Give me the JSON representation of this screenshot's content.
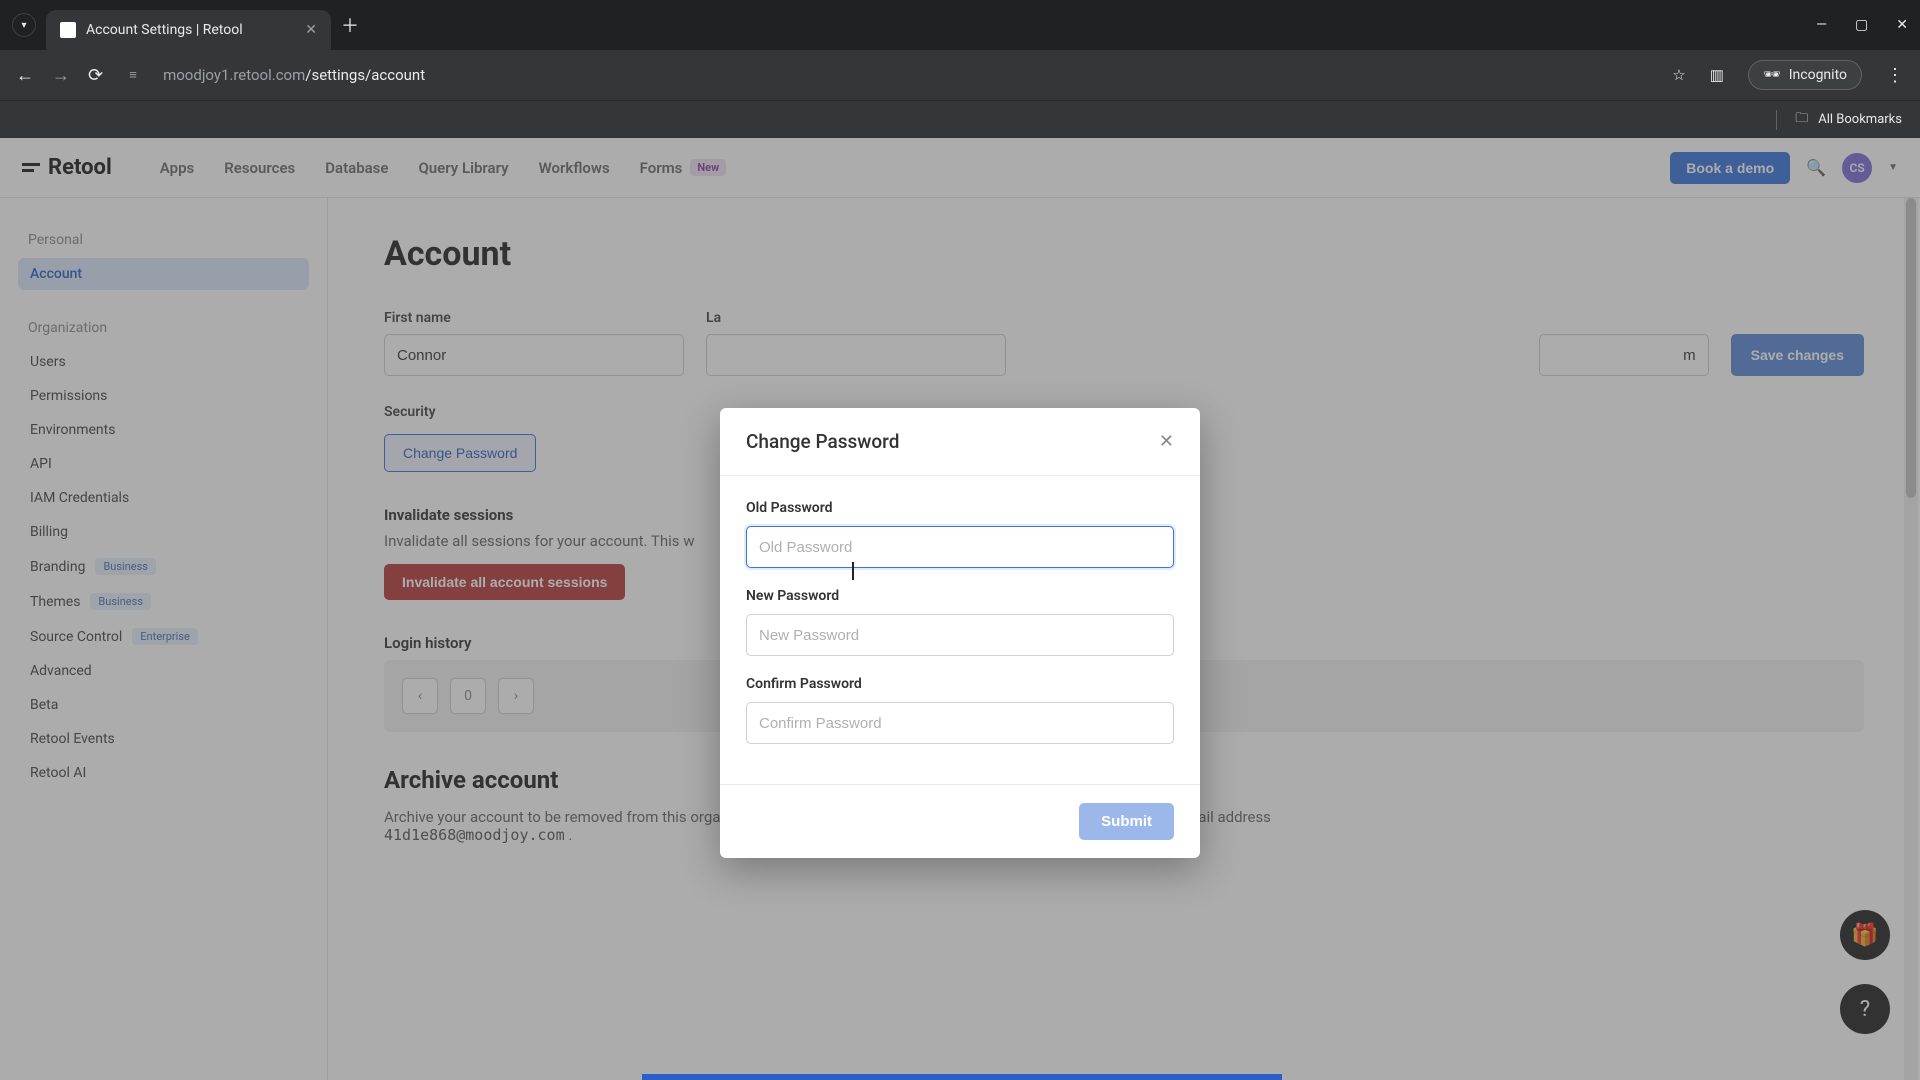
{
  "browser": {
    "tab_title": "Account Settings | Retool",
    "url_muted_prefix": "moodjoy1.retool.com",
    "url_path": "/settings/account",
    "incognito_label": "Incognito",
    "all_bookmarks": "All Bookmarks"
  },
  "topbar": {
    "brand": "Retool",
    "menu": [
      "Apps",
      "Resources",
      "Database",
      "Query Library",
      "Workflows",
      "Forms"
    ],
    "forms_badge": "New",
    "book_demo": "Book a demo",
    "avatar_initials": "CS"
  },
  "sidebar": {
    "group_personal": "Personal",
    "group_org": "Organization",
    "items_personal": [
      {
        "label": "Account",
        "active": true
      }
    ],
    "items_org": [
      {
        "label": "Users"
      },
      {
        "label": "Permissions"
      },
      {
        "label": "Environments"
      },
      {
        "label": "API"
      },
      {
        "label": "IAM Credentials"
      },
      {
        "label": "Billing"
      },
      {
        "label": "Branding",
        "badge": "Business"
      },
      {
        "label": "Themes",
        "badge": "Business"
      },
      {
        "label": "Source Control",
        "badge": "Enterprise"
      },
      {
        "label": "Advanced"
      },
      {
        "label": "Beta"
      },
      {
        "label": "Retool Events"
      },
      {
        "label": "Retool AI"
      }
    ]
  },
  "main": {
    "heading": "Account",
    "first_name_label": "First name",
    "first_name_value": "Connor",
    "last_name_label_trunc": "La",
    "email_trunc": "m",
    "save_changes": "Save changes",
    "security_label": "Security",
    "change_password_btn": "Change Password",
    "invalidate_title": "Invalidate sessions",
    "invalidate_desc": "Invalidate all sessions for your account. This w",
    "invalidate_btn": "Invalidate all account sessions",
    "login_history_title": "Login history",
    "pager_page": "0",
    "archive_title": "Archive account",
    "archive_desc_1": "Archive your account to be removed from this organization. You will be able to join other Retool organizations using the email address ",
    "archive_email": "41d1e868@moodjoy.com",
    "archive_desc_2": " ."
  },
  "modal": {
    "title": "Change Password",
    "old_label": "Old Password",
    "old_placeholder": "Old Password",
    "new_label": "New Password",
    "new_placeholder": "New Password",
    "confirm_label": "Confirm Password",
    "confirm_placeholder": "Confirm Password",
    "submit": "Submit"
  }
}
